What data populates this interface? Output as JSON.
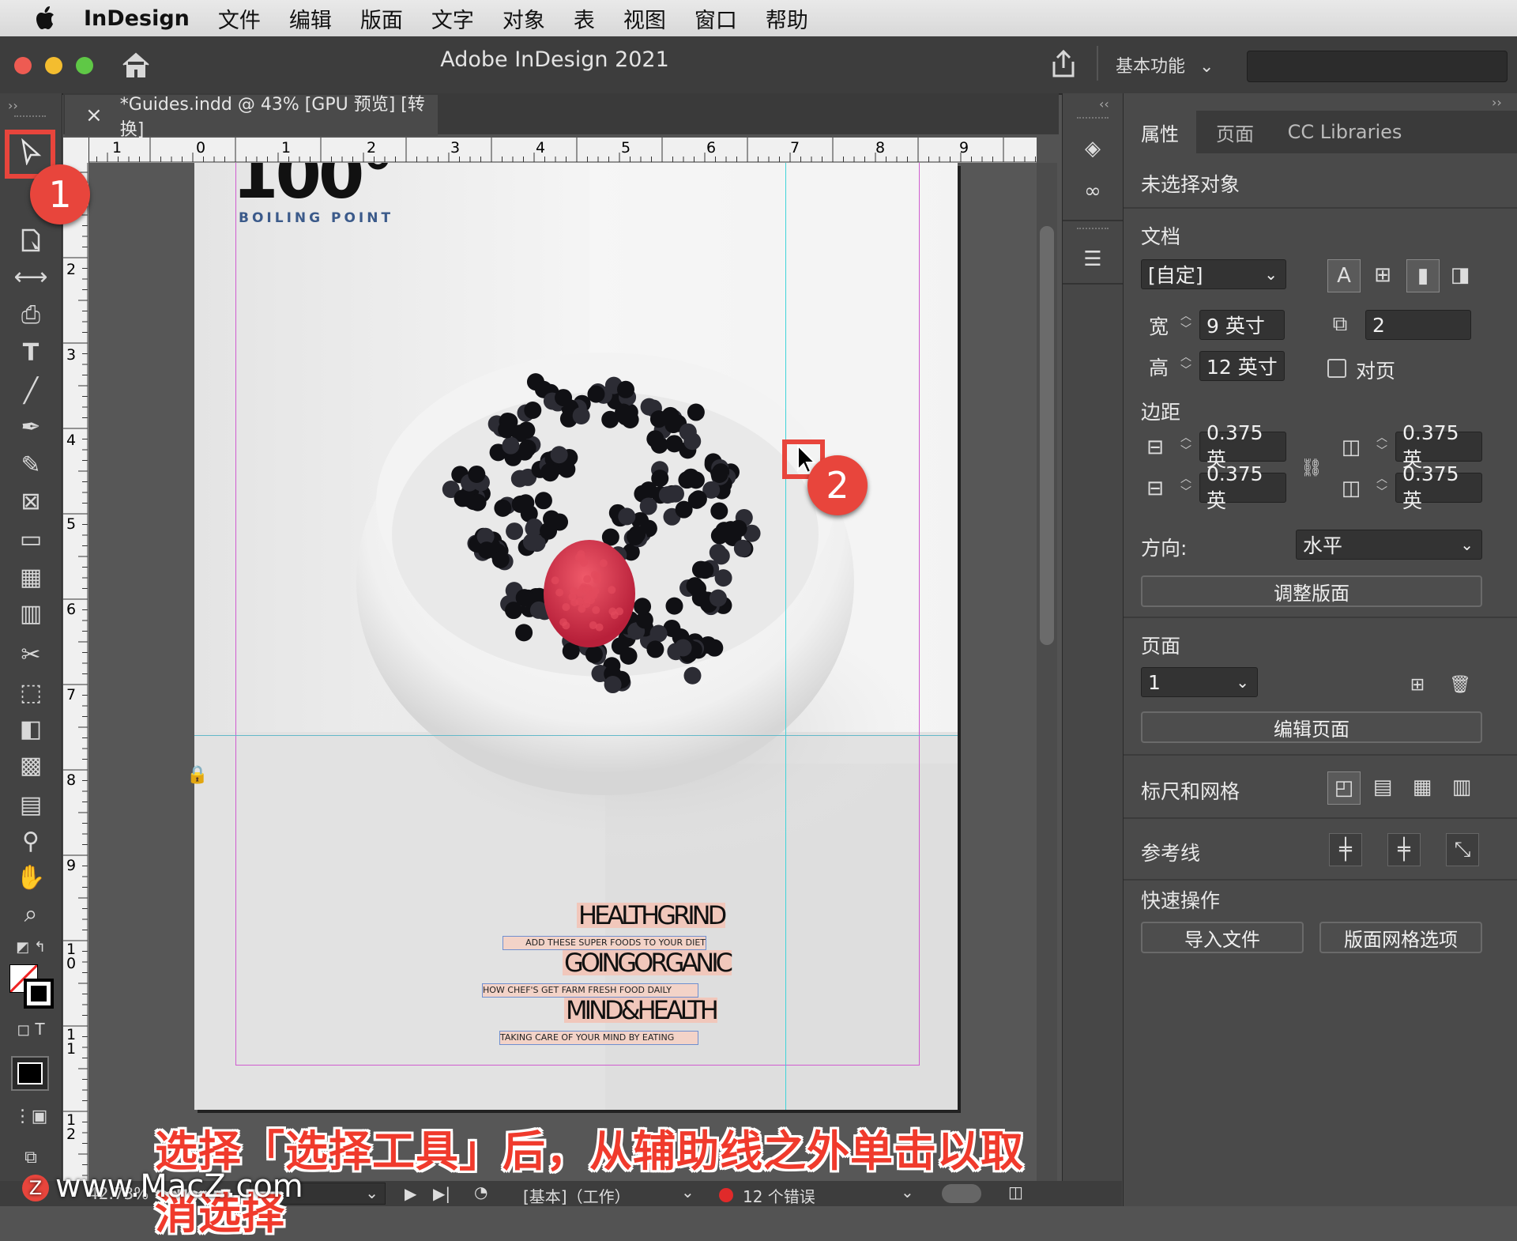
{
  "menubar": {
    "items": [
      "InDesign",
      "文件",
      "编辑",
      "版面",
      "文字",
      "对象",
      "表",
      "视图",
      "窗口",
      "帮助"
    ]
  },
  "window": {
    "title": "Adobe InDesign 2021",
    "workspace": "基本功能"
  },
  "document": {
    "tab_label": "*Guides.indd @ 43% [GPU 预览] [转换]",
    "close_glyph": "×"
  },
  "rulers": {
    "horizontal": [
      "1",
      "0",
      "1",
      "2",
      "3",
      "4",
      "5",
      "6",
      "7",
      "8",
      "9"
    ],
    "vertical": [
      "2",
      "3",
      "4",
      "5",
      "6",
      "7",
      "8",
      "9",
      "10",
      "11",
      "12"
    ]
  },
  "page_content": {
    "masthead_number": "100°",
    "masthead_sub": "BOILING POINT",
    "headlines": [
      {
        "title": "HEALTHGRIND",
        "subtitle": "ADD THESE SUPER FOODS TO YOUR DIET"
      },
      {
        "title": "GOINGORGANIC",
        "subtitle": "HOW CHEF'S GET FARM FRESH FOOD DAILY"
      },
      {
        "title": "MIND&HEALTH",
        "subtitle": "TAKING CARE OF YOUR MIND BY EATING"
      }
    ]
  },
  "panel": {
    "tabs": [
      "属性",
      "页面",
      "CC Libraries"
    ],
    "no_selection": "未选择对象",
    "document_section": "文档",
    "preset": "[自定]",
    "width_label": "宽",
    "width_value": "9 英寸",
    "height_label": "高",
    "height_value": "12 英寸",
    "pages_count": "2",
    "facing_pages": "对页",
    "margins_section": "边距",
    "margin_top": "0.375 英",
    "margin_bottom": "0.375 英",
    "margin_left": "0.375 英",
    "margin_right": "0.375 英",
    "orientation_label": "方向:",
    "orientation_value": "水平",
    "adjust_layout": "调整版面",
    "pages_section": "页面",
    "page_value": "1",
    "edit_page": "编辑页面",
    "rulers_grids": "标尺和网格",
    "guides": "参考线",
    "quick_actions": "快速操作",
    "import_file": "导入文件",
    "layout_grid_options": "版面网格选项"
  },
  "status": {
    "zoom": "42.73%",
    "preflight_profile": "[基本]（工作）",
    "errors": "12 个错误"
  },
  "overlay": {
    "badge1": "1",
    "badge2": "2",
    "caption": "选择「选择工具」后，从辅助线之外单击以取消选择",
    "watermark": "www.MacZ.com"
  },
  "colors": {
    "badge": "#e8453c",
    "guide_cyan": "#3fd3d9",
    "margin_magenta": "#d05cd0",
    "highlight_box": "#e8453c"
  }
}
